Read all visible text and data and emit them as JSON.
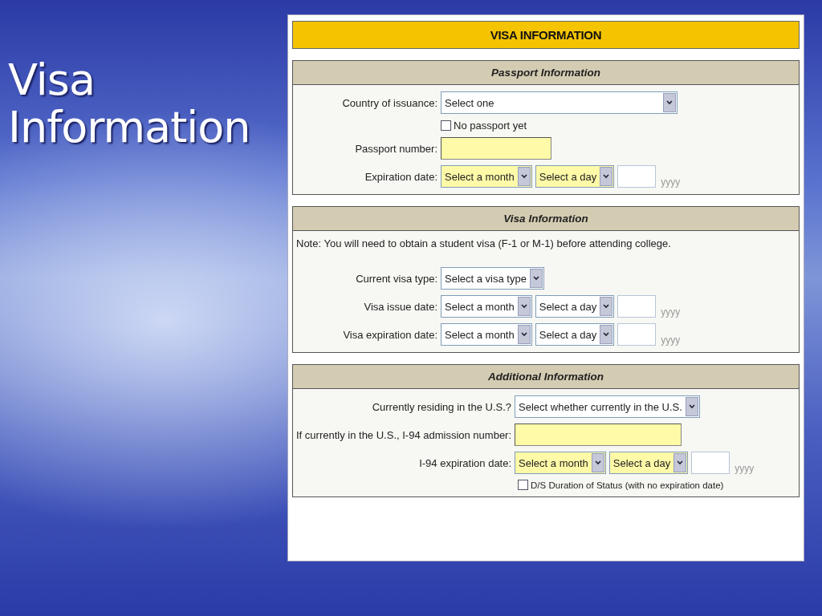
{
  "slide_title": "Visa Information",
  "form": {
    "title": "VISA INFORMATION",
    "sections": [
      {
        "title": "Passport Information",
        "rows": [
          {
            "kind": "select",
            "label": "Country of issuance:",
            "value": "Select one",
            "highlighted": false
          },
          {
            "kind": "checkbox",
            "text": "No passport yet",
            "checked": false
          },
          {
            "kind": "text",
            "label": "Passport number:",
            "highlighted": true
          },
          {
            "kind": "date",
            "label": "Expiration date:",
            "month": "Select a month",
            "day": "Select a day",
            "year_hint": "yyyy",
            "highlighted": true
          }
        ]
      },
      {
        "title": "Visa Information",
        "note": "Note: You will need to obtain a student visa (F-1 or M-1) before attending college.",
        "rows": [
          {
            "kind": "select",
            "label": "Current visa type:",
            "value": "Select a visa type",
            "highlighted": false
          },
          {
            "kind": "date",
            "label": "Visa issue date:",
            "month": "Select a month",
            "day": "Select a day",
            "year_hint": "yyyy",
            "highlighted": false
          },
          {
            "kind": "date",
            "label": "Visa expiration date:",
            "month": "Select a month",
            "day": "Select a day",
            "year_hint": "yyyy",
            "highlighted": false
          }
        ]
      },
      {
        "title": "Additional Information",
        "rows": [
          {
            "kind": "select",
            "label": "Currently residing in the U.S.?",
            "value": "Select whether currently in the U.S.",
            "highlighted": false
          },
          {
            "kind": "text",
            "label": "If currently in the U.S., I-94 admission number:",
            "highlighted": true
          },
          {
            "kind": "date",
            "label": "I-94 expiration date:",
            "month": "Select a month",
            "day": "Select a day",
            "year_hint": "yyyy",
            "highlighted": true
          },
          {
            "kind": "checkbox",
            "text": "D/S Duration of Status (with no expiration date)",
            "checked": false
          }
        ]
      }
    ]
  }
}
